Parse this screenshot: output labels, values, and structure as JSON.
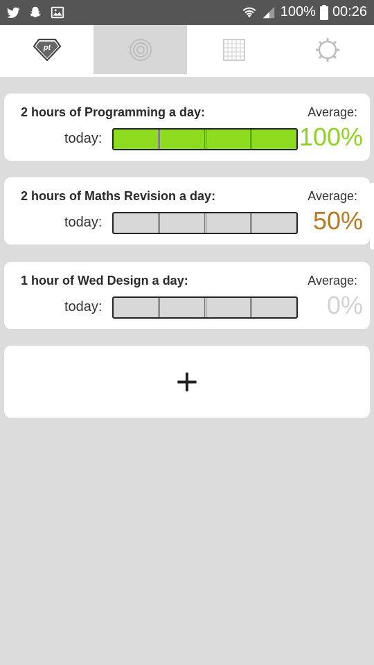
{
  "status_bar": {
    "icons_left": [
      "twitter-icon",
      "snapchat-icon",
      "gallery-icon"
    ],
    "battery_percent": "100%",
    "time": "00:26"
  },
  "tabs": [
    {
      "name": "goals",
      "icon": "gem-logo-icon",
      "logo_text": "pt",
      "active": false
    },
    {
      "name": "focus",
      "icon": "target-icon",
      "active": true
    },
    {
      "name": "calendar",
      "icon": "calendar-grid-icon",
      "active": false
    },
    {
      "name": "settings",
      "icon": "gear-icon",
      "active": false
    }
  ],
  "goals": [
    {
      "title": "2 hours of Programming a day:",
      "today_label": "today:",
      "average_label": "Average:",
      "average_value": "100%",
      "average_color": "#8fd31f",
      "progress_fraction": 1.0,
      "segments": 4,
      "bar_fill_color": "#8ddc1f"
    },
    {
      "title": "2 hours of Maths Revision a day:",
      "today_label": "today:",
      "average_label": "Average:",
      "average_value": "50%",
      "average_color": "#b7791f",
      "progress_fraction": 0.0,
      "segments": 4,
      "bar_fill_color": "#8ddc1f"
    },
    {
      "title": "1 hour of Wed Design a day:",
      "today_label": "today:",
      "average_label": "Average:",
      "average_value": "0%",
      "average_color": "#d2d2d2",
      "progress_fraction": 0.0,
      "segments": 4,
      "bar_fill_color": "#8ddc1f"
    }
  ],
  "add_button": {
    "label": "+"
  }
}
